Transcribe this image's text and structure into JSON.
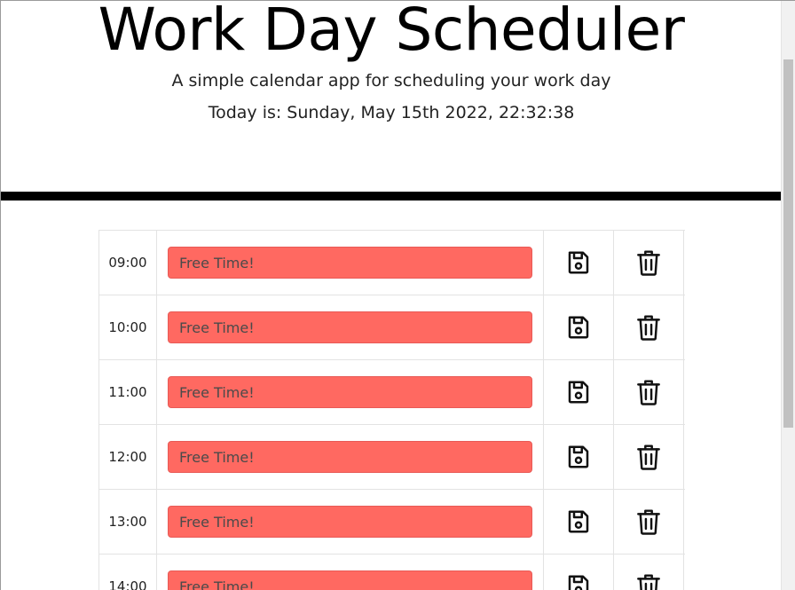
{
  "header": {
    "title": "Work Day Scheduler",
    "subtitle": "A simple calendar app for scheduling your work day",
    "today": "Today is: Sunday, May 15th 2022, 22:32:38"
  },
  "colors": {
    "past_slot": "#ff6961",
    "divider": "#000000"
  },
  "icons": {
    "save": "floppy-disk-icon",
    "delete": "trash-can-icon"
  },
  "schedule": [
    {
      "hour": "09:00",
      "placeholder": "Free Time!"
    },
    {
      "hour": "10:00",
      "placeholder": "Free Time!"
    },
    {
      "hour": "11:00",
      "placeholder": "Free Time!"
    },
    {
      "hour": "12:00",
      "placeholder": "Free Time!"
    },
    {
      "hour": "13:00",
      "placeholder": "Free Time!"
    },
    {
      "hour": "14:00",
      "placeholder": "Free Time!"
    }
  ]
}
